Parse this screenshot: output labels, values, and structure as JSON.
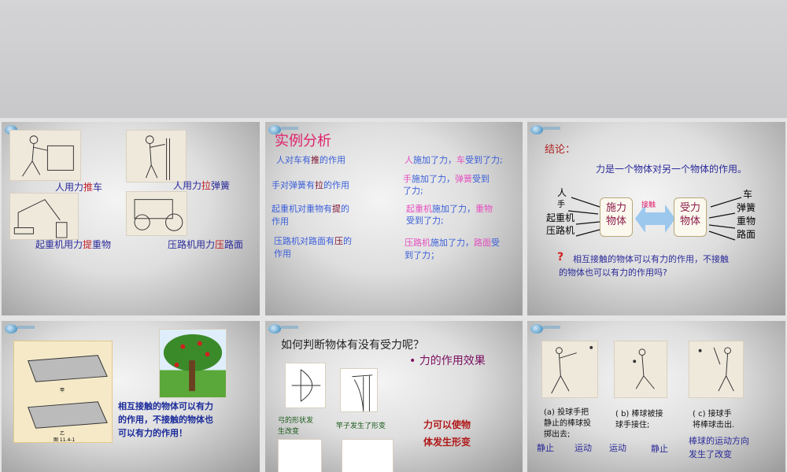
{
  "slide1": {
    "labels": [
      [
        {
          "t": "人用力",
          "c": "blue"
        },
        {
          "t": "推",
          "c": "red"
        },
        {
          "t": "车",
          "c": "blue"
        }
      ],
      [
        {
          "t": "人用力",
          "c": "blue"
        },
        {
          "t": "拉",
          "c": "red"
        },
        {
          "t": "弹簧",
          "c": "blue"
        }
      ],
      [
        {
          "t": "起重机用力",
          "c": "blue"
        },
        {
          "t": "提",
          "c": "red"
        },
        {
          "t": "重物",
          "c": "blue"
        }
      ],
      [
        {
          "t": "压路机用力",
          "c": "blue"
        },
        {
          "t": "压",
          "c": "red"
        },
        {
          "t": "路面",
          "c": "blue"
        }
      ]
    ]
  },
  "slide2": {
    "title": "实例分析",
    "left": [
      [
        {
          "t": "人对车有",
          "c": "lblue"
        },
        {
          "t": "推",
          "c": "dred"
        },
        {
          "t": "的作用",
          "c": "lblue"
        }
      ],
      [
        {
          "t": "手对弹簧有",
          "c": "lblue"
        },
        {
          "t": "拉",
          "c": "dred"
        },
        {
          "t": "的作用",
          "c": "lblue"
        }
      ],
      [
        {
          "t": "起重机对重物有",
          "c": "lblue"
        },
        {
          "t": "提",
          "c": "dred"
        },
        {
          "t": "的\n作用",
          "c": "lblue"
        }
      ],
      [
        {
          "t": "压路机对路面有",
          "c": "lblue"
        },
        {
          "t": "压",
          "c": "dred"
        },
        {
          "t": "的\n作用",
          "c": "lblue"
        }
      ]
    ],
    "right": [
      [
        {
          "t": "人",
          "c": "pink"
        },
        {
          "t": "施加了力，",
          "c": "lblue"
        },
        {
          "t": "车",
          "c": "pink"
        },
        {
          "t": "受到了力;",
          "c": "lblue"
        }
      ],
      [
        {
          "t": "手",
          "c": "pink"
        },
        {
          "t": "施加了力，",
          "c": "lblue"
        },
        {
          "t": "弹簧",
          "c": "pink"
        },
        {
          "t": "受到\n了力;",
          "c": "lblue"
        }
      ],
      [
        {
          "t": "起重机",
          "c": "pink"
        },
        {
          "t": "施加了力，",
          "c": "lblue"
        },
        {
          "t": "重物",
          "c": "pink"
        },
        {
          "t": "\n受到了力;",
          "c": "lblue"
        }
      ],
      [
        {
          "t": "压路机",
          "c": "pink"
        },
        {
          "t": "施加了力，",
          "c": "lblue"
        },
        {
          "t": "路面",
          "c": "pink"
        },
        {
          "t": "受\n到了力；",
          "c": "lblue"
        }
      ]
    ]
  },
  "slide3": {
    "title": "结论：",
    "statement": "力是一个物体对另一个物体的作用。",
    "left_items": [
      "人",
      "手",
      "起重机",
      "压路机"
    ],
    "box_left": "施力\n物体",
    "contact": "接触",
    "box_right": "受力\n物体",
    "right_items": [
      "车",
      "弹簧",
      "重物",
      "路面"
    ],
    "question_mark": "?",
    "question": "相互接触的物体可以有力的作用，不接触\n的物体也可以有力的作用吗?"
  },
  "slide4": {
    "figure_label_a": "甲",
    "figure_label_b": "乙",
    "figure_caption": "图 11.4-1",
    "text": "相互接触的物体可以有力\n的作用，不接触的物体也\n可以有力的作用！"
  },
  "slide5": {
    "title": "如何判断物体有没有受力呢？",
    "bullet": "• 力的作用效果",
    "caption1": "弓的形状发\n生改变",
    "caption2": "竿子发生了形变",
    "conclusion": "力可以使物\n体发生形变"
  },
  "slide6": {
    "captions": [
      "(a) 投球手把\n静止的棒球投\n掷出去;",
      "( b) 棒球被接\n球手接住;",
      "( c) 接球手\n将棒球击出."
    ],
    "states": [
      "静止",
      "运动",
      "运动",
      "静止"
    ],
    "change": "棒球的运动方向\n发生了改变"
  }
}
